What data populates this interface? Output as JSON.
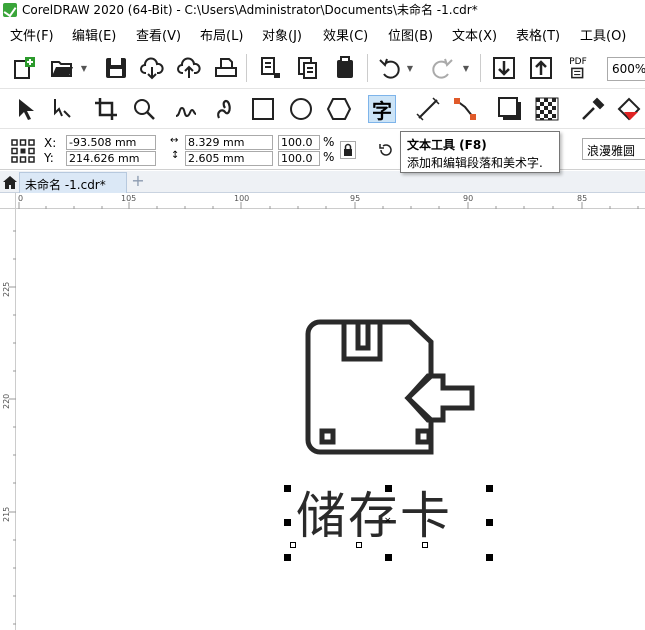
{
  "window": {
    "title": "CorelDRAW 2020 (64-Bit) - C:\\Users\\Administrator\\Documents\\未命名 -1.cdr*"
  },
  "menu": [
    "文件(F)",
    "编辑(E)",
    "查看(V)",
    "布局(L)",
    "对象(J)",
    "效果(C)",
    "位图(B)",
    "文本(X)",
    "表格(T)",
    "工具(O)"
  ],
  "standard_toolbar": {
    "zoom": "600%",
    "pdf_label": "PDF"
  },
  "property_bar": {
    "x_label": "X:",
    "y_label": "Y:",
    "x_value": "-93.508 mm",
    "y_value": "214.626 mm",
    "width_value": "8.329 mm",
    "height_value": "2.605 mm",
    "scale_w": "100.0",
    "scale_h": "100.0",
    "percent": "%",
    "font_name": "浪漫雅圆"
  },
  "tooltip": {
    "title": "文本工具 (F8)",
    "description": "添加和编辑段落和美术字."
  },
  "tabs": {
    "doc_tab": "未命名 -1.cdr*"
  },
  "rulers": {
    "horizontal": [
      "0",
      "105",
      "100",
      "95",
      "90",
      "85"
    ],
    "vertical": [
      "225",
      "220",
      "215"
    ]
  },
  "canvas": {
    "artwork_text": "储存卡"
  },
  "colors": {
    "accent": "#7eb4ea",
    "active_tool_bg": "#cce4f7",
    "artwork_stroke": "#2a2a2a"
  }
}
